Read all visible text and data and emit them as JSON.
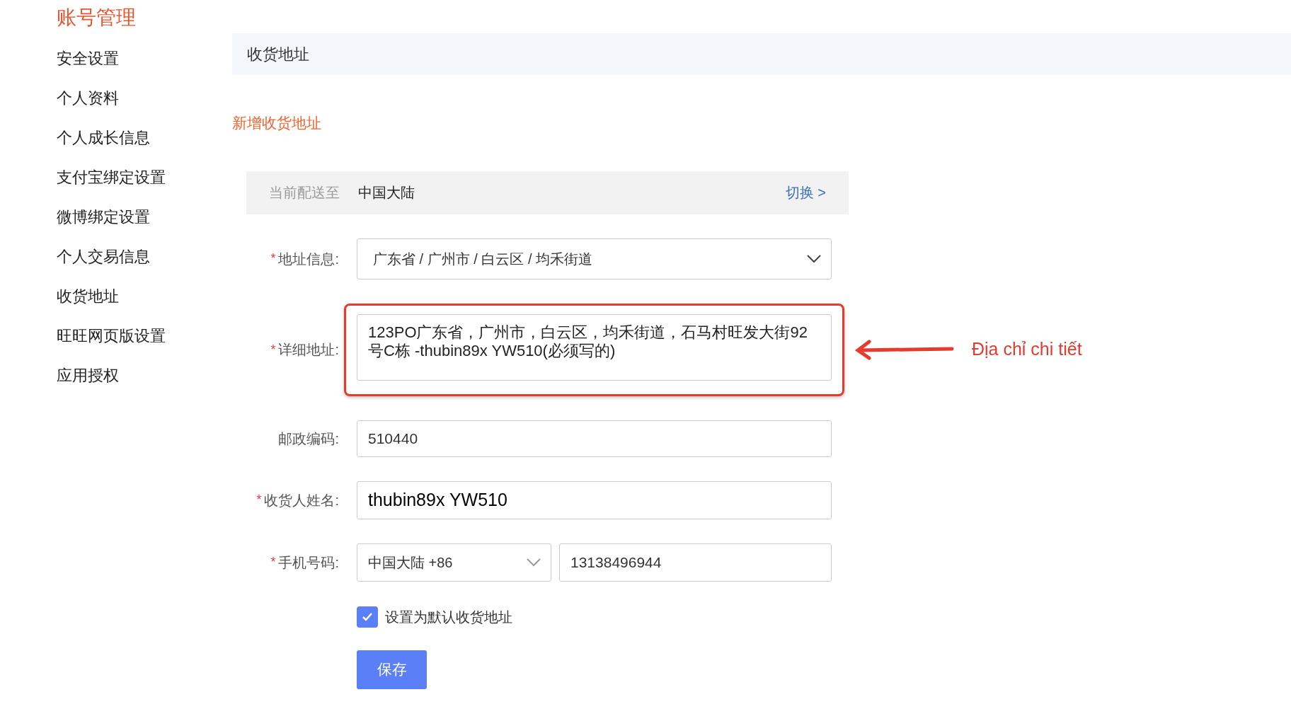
{
  "sidebar": {
    "title": "账号管理",
    "items": [
      {
        "label": "安全设置"
      },
      {
        "label": "个人资料"
      },
      {
        "label": "个人成长信息"
      },
      {
        "label": "支付宝绑定设置"
      },
      {
        "label": "微博绑定设置"
      },
      {
        "label": "个人交易信息"
      },
      {
        "label": "收货地址"
      },
      {
        "label": "旺旺网页版设置"
      },
      {
        "label": "应用授权"
      }
    ]
  },
  "header": {
    "title": "收货地址"
  },
  "add_link": "新增收货地址",
  "delivery_bar": {
    "label": "当前配送至",
    "region": "中国大陆",
    "switch_link": "切换 >"
  },
  "form": {
    "fields": [
      {
        "kind": "select",
        "label": "地址信息:",
        "required_mark": "*",
        "value": "广东省 / 广州市 / 白云区 / 均禾街道"
      },
      {
        "kind": "textarea",
        "label": "详细地址:",
        "required_mark": "*",
        "highlighted": true,
        "value": "123PO广东省，广州市，白云区，均禾街道，石马村旺发大街92号C栋 -thubin89x YW510(必须写的)"
      },
      {
        "kind": "input",
        "label": "邮政编码:",
        "large": false,
        "value": "510440"
      },
      {
        "kind": "input",
        "label": "收货人姓名:",
        "required_mark": "*",
        "large": true,
        "value": "thubin89x YW510"
      },
      {
        "kind": "phone",
        "label": "手机号码:",
        "required_mark": "*",
        "country": "中国大陆 +86",
        "value": "13138496944"
      }
    ],
    "default_checkbox": {
      "label": "设置为默认收货地址",
      "checked": true
    },
    "save_button": "保存"
  },
  "annotation": {
    "text": "Địa chỉ chi tiết"
  }
}
